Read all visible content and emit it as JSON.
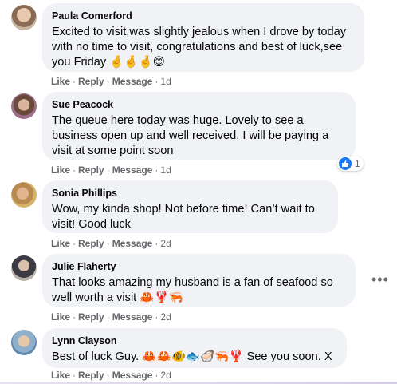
{
  "comments": [
    {
      "author": "Paula Comerford",
      "text": "Excited to visit,was slightly jealous when I drove by today with no time to visit, congratulations and best of luck,see you Friday 🤞🤞🤞😊",
      "like": "Like",
      "reply": "Reply",
      "message": "Message",
      "time": "1d"
    },
    {
      "author": "Sue Peacock",
      "text": "The queue here today was huge. Lovely to see a business open up and well received. I will be paying a visit at some point soon",
      "like": "Like",
      "reply": "Reply",
      "message": "Message",
      "time": "1d",
      "reaction_count": "1"
    },
    {
      "author": "Sonia Phillips",
      "text": "Wow, my kinda shop! Not before time! Can’t wait to visit! Good luck",
      "like": "Like",
      "reply": "Reply",
      "message": "Message",
      "time": "2d"
    },
    {
      "author": "Julie Flaherty",
      "text": "That looks amazing my husband is a fan of seafood so well worth a visit 🦀🦞🦐",
      "like": "Like",
      "reply": "Reply",
      "message": "Message",
      "time": "2d"
    },
    {
      "author": "Lynn Clayson",
      "text": "Best of luck Guy. 🦀🦀🐠🐟🦪🦐🦞 See you soon. X",
      "like": "Like",
      "reply": "Reply",
      "message": "Message",
      "time": "2d"
    }
  ],
  "colors": {
    "bubble": "#f0f2f5",
    "meta": "#65676b",
    "text": "#050505",
    "like_blue": "#1877f2"
  }
}
